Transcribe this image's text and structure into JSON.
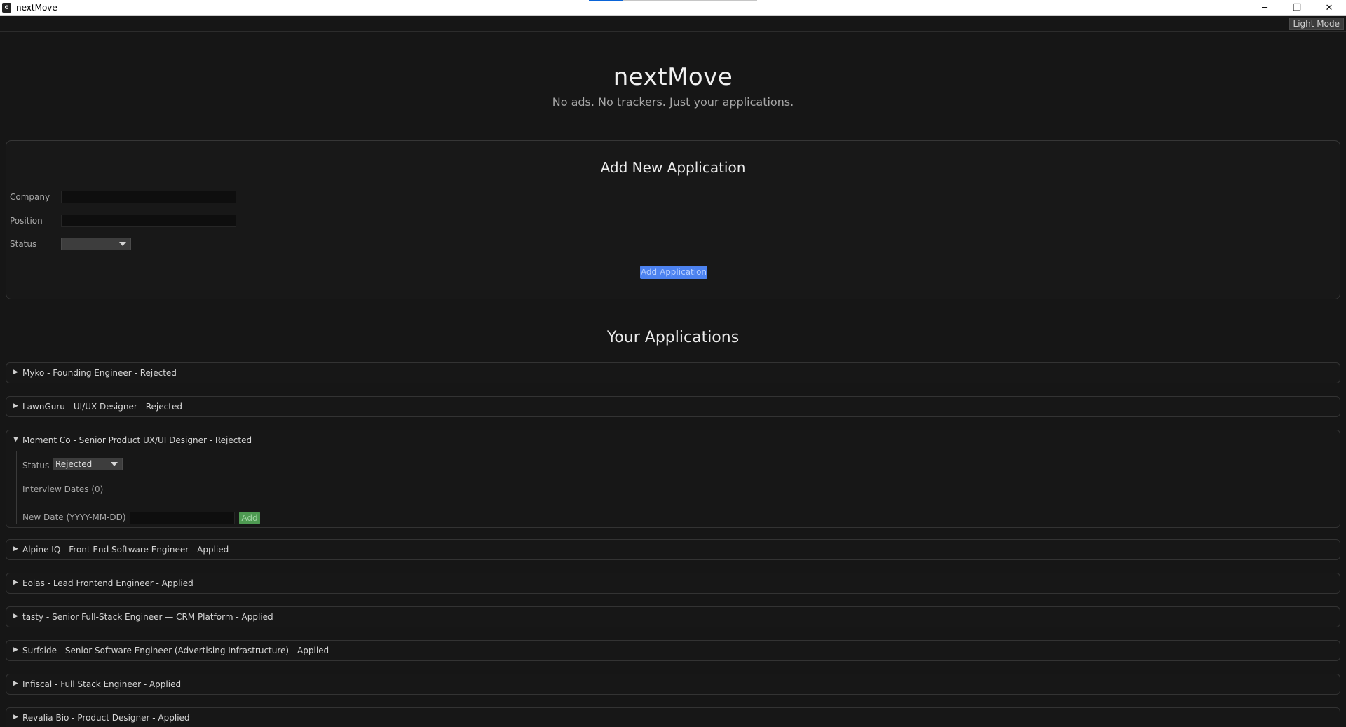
{
  "window": {
    "title": "nextMove",
    "icon": "e",
    "minimize": "─",
    "maximize": "❐",
    "close": "✕"
  },
  "mode_toggle": "Light Mode",
  "header": {
    "title": "nextMove",
    "subtitle": "No ads. No trackers. Just your applications."
  },
  "add_form": {
    "title": "Add New Application",
    "company_label": "Company",
    "position_label": "Position",
    "status_label": "Status",
    "submit_label": "Add Application"
  },
  "applications": {
    "title": "Your Applications",
    "items": [
      {
        "label": "Myko - Founding Engineer - Rejected"
      },
      {
        "label": "LawnGuru - UI/UX Designer - Rejected"
      },
      {
        "label": "Moment Co - Senior Product UX/UI Designer - Rejected",
        "status_label": "Status",
        "status_value": "Rejected",
        "interview_dates": "Interview Dates (0)",
        "new_date_label": "New Date (YYYY-MM-DD)",
        "add_label": "Add"
      },
      {
        "label": "Alpine IQ - Front End Software Engineer - Applied"
      },
      {
        "label": "Eolas - Lead Frontend Engineer - Applied"
      },
      {
        "label": "tasty - Senior Full-Stack Engineer — CRM Platform - Applied"
      },
      {
        "label": "Surfside - Senior Software Engineer (Advertising Infrastructure) - Applied"
      },
      {
        "label": "Infiscal - Full Stack Engineer - Applied"
      },
      {
        "label": "Revalia Bio - Product Designer - Applied"
      }
    ]
  },
  "icons": {
    "collapsed": "▶",
    "expanded": "▼"
  },
  "colors": {
    "background": "#161616",
    "primary_button": "#4c82f0",
    "add_button": "#4e9a52"
  }
}
